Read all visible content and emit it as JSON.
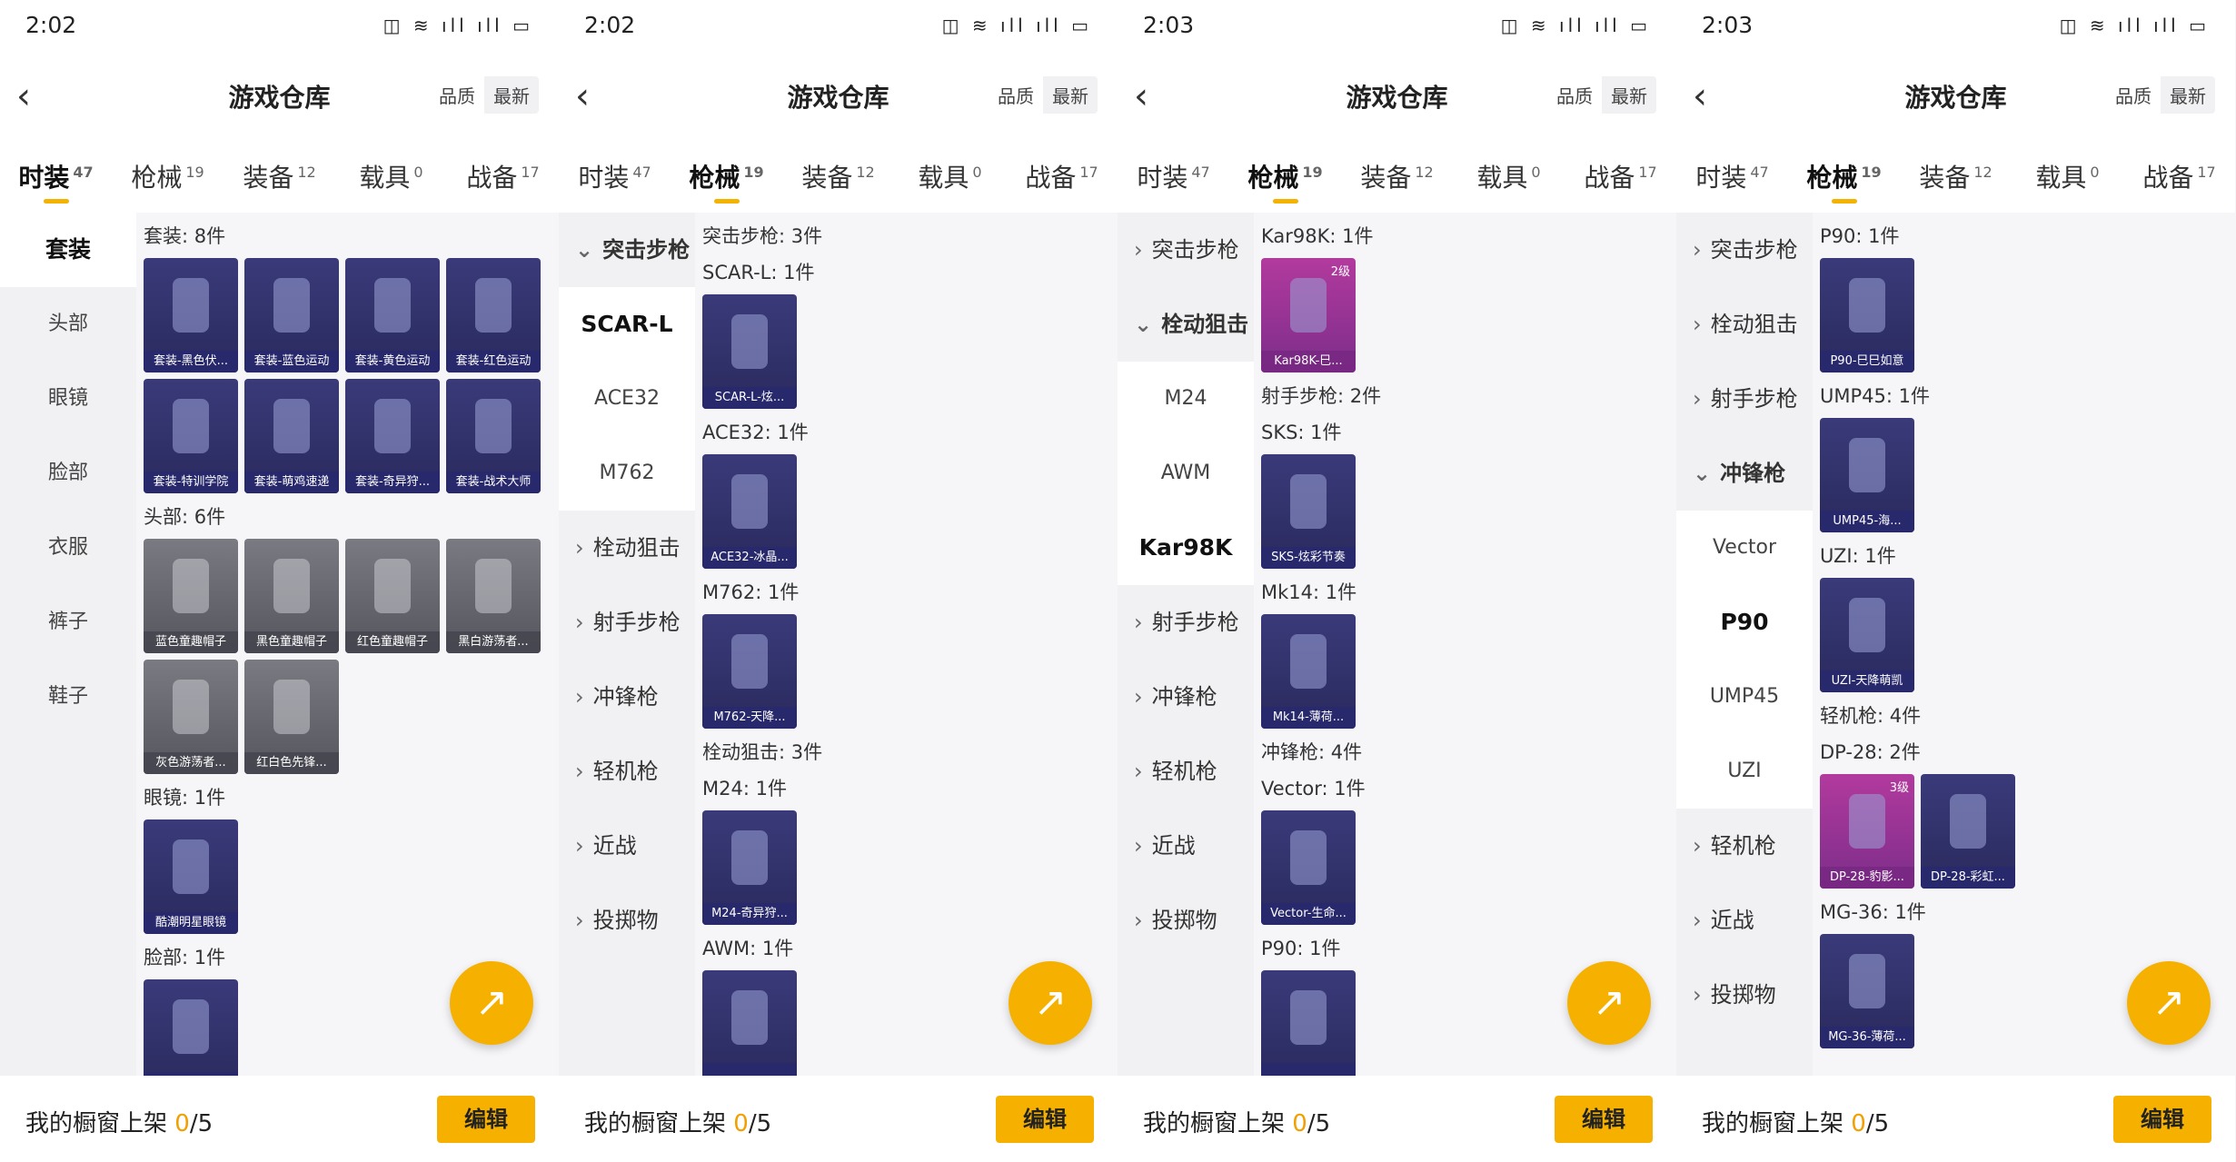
{
  "colors": {
    "accent": "#f6b100",
    "card_purple": "#2f2f6a",
    "card_gray": "#5f5f67",
    "card_pink": "#9a2f90"
  },
  "panels": [
    {
      "time": "2:02",
      "status_icons": "◫ ≋ ıll ıll ▭",
      "back_icon": "‹",
      "title": "游戏仓库",
      "sort": [
        "品质",
        "最新"
      ],
      "tabs": [
        {
          "label": "时装",
          "count": "47"
        },
        {
          "label": "枪械",
          "count": "19"
        },
        {
          "label": "装备",
          "count": "12"
        },
        {
          "label": "载具",
          "count": "0"
        },
        {
          "label": "战备",
          "count": "17"
        }
      ],
      "active_tab": 0,
      "side": [
        {
          "label": "套装",
          "type": "sel"
        },
        {
          "label": "头部",
          "type": "plain"
        },
        {
          "label": "眼镜",
          "type": "plain"
        },
        {
          "label": "脸部",
          "type": "plain"
        },
        {
          "label": "衣服",
          "type": "plain"
        },
        {
          "label": "裤子",
          "type": "plain"
        },
        {
          "label": "鞋子",
          "type": "plain"
        }
      ],
      "sections": [
        {
          "title": "套装: 8件",
          "items": [
            {
              "label": "套装-黑色伏...",
              "style": "purple"
            },
            {
              "label": "套装-蓝色运动",
              "style": "purple"
            },
            {
              "label": "套装-黄色运动",
              "style": "purple"
            },
            {
              "label": "套装-红色运动",
              "style": "purple"
            },
            {
              "label": "套装-特训学院",
              "style": "purple"
            },
            {
              "label": "套装-萌鸡速递",
              "style": "purple"
            },
            {
              "label": "套装-奇异狩...",
              "style": "purple"
            },
            {
              "label": "套装-战术大师",
              "style": "purple"
            }
          ]
        },
        {
          "title": "头部: 6件",
          "items": [
            {
              "label": "蓝色童趣帽子",
              "style": "gray"
            },
            {
              "label": "黑色童趣帽子",
              "style": "gray"
            },
            {
              "label": "红色童趣帽子",
              "style": "gray"
            },
            {
              "label": "黑白游荡者...",
              "style": "gray"
            },
            {
              "label": "灰色游荡者...",
              "style": "gray"
            },
            {
              "label": "红白色先锋...",
              "style": "gray"
            }
          ]
        },
        {
          "title": "眼镜: 1件",
          "items": [
            {
              "label": "酷潮明星眼镜",
              "style": "purple"
            }
          ]
        },
        {
          "title": "脸部: 1件",
          "items": [
            {
              "label": "",
              "style": "purple"
            }
          ]
        }
      ],
      "bottom": {
        "prefix": "我的橱窗上架 ",
        "count": "0",
        "suffix": "/5",
        "button": "编辑"
      }
    },
    {
      "time": "2:02",
      "status_icons": "◫ ≋ ıll ıll ▭",
      "back_icon": "‹",
      "title": "游戏仓库",
      "sort": [
        "品质",
        "最新"
      ],
      "tabs": [
        {
          "label": "时装",
          "count": "47"
        },
        {
          "label": "枪械",
          "count": "19"
        },
        {
          "label": "装备",
          "count": "12"
        },
        {
          "label": "载具",
          "count": "0"
        },
        {
          "label": "战备",
          "count": "17"
        }
      ],
      "active_tab": 1,
      "side": [
        {
          "label": "突击步枪",
          "type": "cat-open"
        },
        {
          "label": "SCAR-L",
          "type": "sel"
        },
        {
          "label": "ACE32",
          "type": "sub"
        },
        {
          "label": "M762",
          "type": "sub"
        },
        {
          "label": "栓动狙击",
          "type": "cat"
        },
        {
          "label": "射手步枪",
          "type": "cat"
        },
        {
          "label": "冲锋枪",
          "type": "cat"
        },
        {
          "label": "轻机枪",
          "type": "cat"
        },
        {
          "label": "近战",
          "type": "cat"
        },
        {
          "label": "投掷物",
          "type": "cat"
        }
      ],
      "sections": [
        {
          "title": "突击步枪: 3件",
          "items": []
        },
        {
          "title": "SCAR-L: 1件",
          "items": [
            {
              "label": "SCAR-L-炫...",
              "style": "purple"
            }
          ]
        },
        {
          "title": "ACE32: 1件",
          "items": [
            {
              "label": "ACE32-冰晶...",
              "style": "purple"
            }
          ]
        },
        {
          "title": "M762: 1件",
          "items": [
            {
              "label": "M762-天降...",
              "style": "purple"
            }
          ]
        },
        {
          "title": "栓动狙击: 3件",
          "items": []
        },
        {
          "title": "M24: 1件",
          "items": [
            {
              "label": "M24-奇异狩...",
              "style": "purple"
            }
          ]
        },
        {
          "title": "AWM: 1件",
          "items": [
            {
              "label": "",
              "style": "purple"
            }
          ]
        }
      ],
      "bottom": {
        "prefix": "我的橱窗上架 ",
        "count": "0",
        "suffix": "/5",
        "button": "编辑"
      }
    },
    {
      "time": "2:03",
      "status_icons": "◫ ≋ ıll ıll ▭",
      "back_icon": "‹",
      "title": "游戏仓库",
      "sort": [
        "品质",
        "最新"
      ],
      "tabs": [
        {
          "label": "时装",
          "count": "47"
        },
        {
          "label": "枪械",
          "count": "19"
        },
        {
          "label": "装备",
          "count": "12"
        },
        {
          "label": "载具",
          "count": "0"
        },
        {
          "label": "战备",
          "count": "17"
        }
      ],
      "active_tab": 1,
      "side": [
        {
          "label": "突击步枪",
          "type": "cat"
        },
        {
          "label": "栓动狙击",
          "type": "cat-open"
        },
        {
          "label": "M24",
          "type": "sub"
        },
        {
          "label": "AWM",
          "type": "sub"
        },
        {
          "label": "Kar98K",
          "type": "sel"
        },
        {
          "label": "射手步枪",
          "type": "cat"
        },
        {
          "label": "冲锋枪",
          "type": "cat"
        },
        {
          "label": "轻机枪",
          "type": "cat"
        },
        {
          "label": "近战",
          "type": "cat"
        },
        {
          "label": "投掷物",
          "type": "cat"
        }
      ],
      "sections": [
        {
          "title": "Kar98K: 1件",
          "items": [
            {
              "label": "Kar98K-巳...",
              "style": "pink",
              "level": "2级"
            }
          ]
        },
        {
          "title": "射手步枪: 2件",
          "items": []
        },
        {
          "title": "SKS: 1件",
          "items": [
            {
              "label": "SKS-炫彩节奏",
              "style": "purple"
            }
          ]
        },
        {
          "title": "Mk14: 1件",
          "items": [
            {
              "label": "Mk14-薄荷...",
              "style": "purple"
            }
          ]
        },
        {
          "title": "冲锋枪: 4件",
          "items": []
        },
        {
          "title": "Vector: 1件",
          "items": [
            {
              "label": "Vector-生命...",
              "style": "purple"
            }
          ]
        },
        {
          "title": "P90: 1件",
          "items": [
            {
              "label": "",
              "style": "purple"
            }
          ]
        }
      ],
      "bottom": {
        "prefix": "我的橱窗上架 ",
        "count": "0",
        "suffix": "/5",
        "button": "编辑"
      }
    },
    {
      "time": "2:03",
      "status_icons": "◫ ≋ ıll ıll ▭",
      "back_icon": "‹",
      "title": "游戏仓库",
      "sort": [
        "品质",
        "最新"
      ],
      "tabs": [
        {
          "label": "时装",
          "count": "47"
        },
        {
          "label": "枪械",
          "count": "19"
        },
        {
          "label": "装备",
          "count": "12"
        },
        {
          "label": "载具",
          "count": "0"
        },
        {
          "label": "战备",
          "count": "17"
        }
      ],
      "active_tab": 1,
      "side": [
        {
          "label": "突击步枪",
          "type": "cat"
        },
        {
          "label": "栓动狙击",
          "type": "cat"
        },
        {
          "label": "射手步枪",
          "type": "cat"
        },
        {
          "label": "冲锋枪",
          "type": "cat-open"
        },
        {
          "label": "Vector",
          "type": "sub"
        },
        {
          "label": "P90",
          "type": "sel"
        },
        {
          "label": "UMP45",
          "type": "sub"
        },
        {
          "label": "UZI",
          "type": "sub"
        },
        {
          "label": "轻机枪",
          "type": "cat"
        },
        {
          "label": "近战",
          "type": "cat"
        },
        {
          "label": "投掷物",
          "type": "cat"
        }
      ],
      "sections": [
        {
          "title": "P90: 1件",
          "items": [
            {
              "label": "P90-巳巳如意",
              "style": "purple"
            }
          ]
        },
        {
          "title": "UMP45: 1件",
          "items": [
            {
              "label": "UMP45-海...",
              "style": "purple"
            }
          ]
        },
        {
          "title": "UZI: 1件",
          "items": [
            {
              "label": "UZI-天降萌凯",
              "style": "purple"
            }
          ]
        },
        {
          "title": "轻机枪: 4件",
          "items": []
        },
        {
          "title": "DP-28: 2件",
          "items": [
            {
              "label": "DP-28-豹影...",
              "style": "pink",
              "level": "3级"
            },
            {
              "label": "DP-28-彩虹...",
              "style": "purple"
            }
          ]
        },
        {
          "title": "MG-36: 1件",
          "items": [
            {
              "label": "MG-36-薄荷...",
              "style": "purple"
            }
          ]
        }
      ],
      "bottom": {
        "prefix": "我的橱窗上架 ",
        "count": "0",
        "suffix": "/5",
        "button": "编辑"
      },
      "fab_icon": "↗"
    }
  ]
}
